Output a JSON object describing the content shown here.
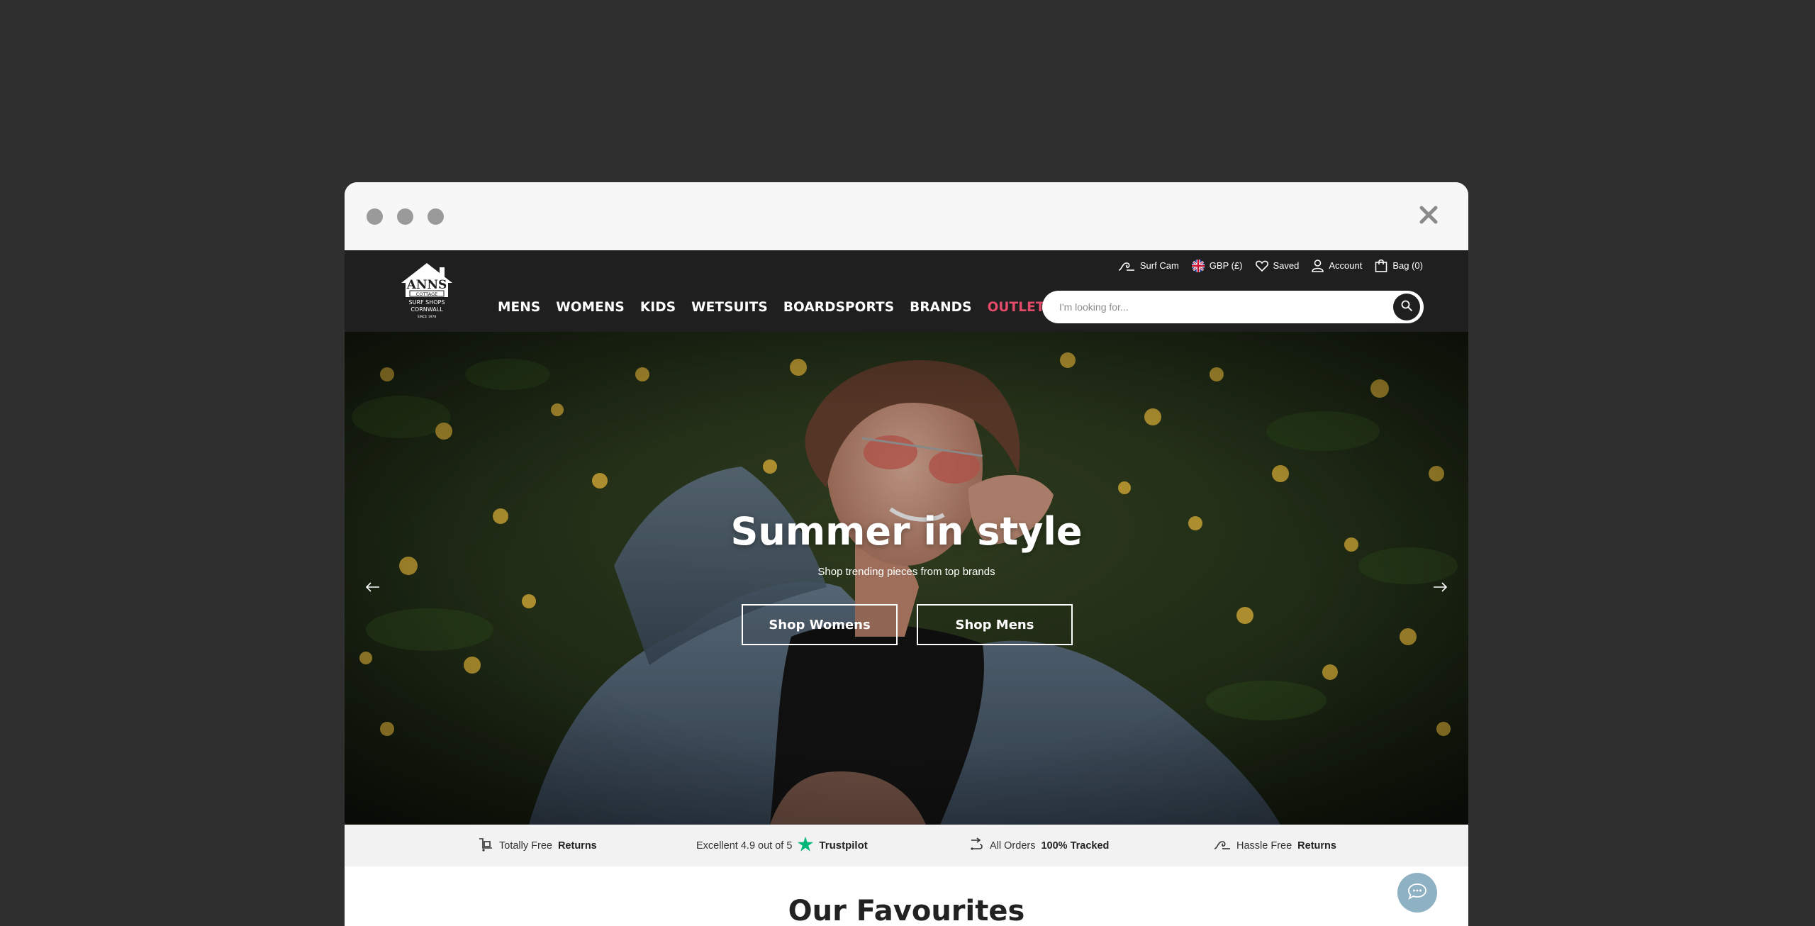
{
  "header": {
    "logo_alt": "Ann's Cottage Surf Shops Cornwall",
    "nav": [
      {
        "label": "MENS"
      },
      {
        "label": "WOMENS"
      },
      {
        "label": "KIDS"
      },
      {
        "label": "WETSUITS"
      },
      {
        "label": "BOARDSPORTS"
      },
      {
        "label": "BRANDS"
      },
      {
        "label": "OUTLET"
      }
    ],
    "utility": {
      "surf_cam": "Surf Cam",
      "currency": "GBP (£)",
      "saved": "Saved",
      "account": "Account",
      "bag": "Bag (0)"
    },
    "search": {
      "placeholder": "I'm looking for..."
    }
  },
  "hero": {
    "title": "Summer in style",
    "subtitle": "Shop trending pieces from top brands",
    "button_womens": "Shop Womens",
    "button_mens": "Shop Mens"
  },
  "usp": {
    "item1_text": "Totally Free",
    "item1_bold": "Returns",
    "item2_text": "Excellent 4.9 out of 5",
    "item2_brand": "Trustpilot",
    "item3_text": "All Orders",
    "item3_bold": "100% Tracked",
    "item4_text": "Hassle Free",
    "item4_bold": "Returns"
  },
  "section": {
    "title": "Our Favourites"
  },
  "colors": {
    "header_bg": "#1f1f1f",
    "outlet": "#e44b6b",
    "trustpilot": "#00b67a",
    "chat": "#8fb1c4"
  }
}
